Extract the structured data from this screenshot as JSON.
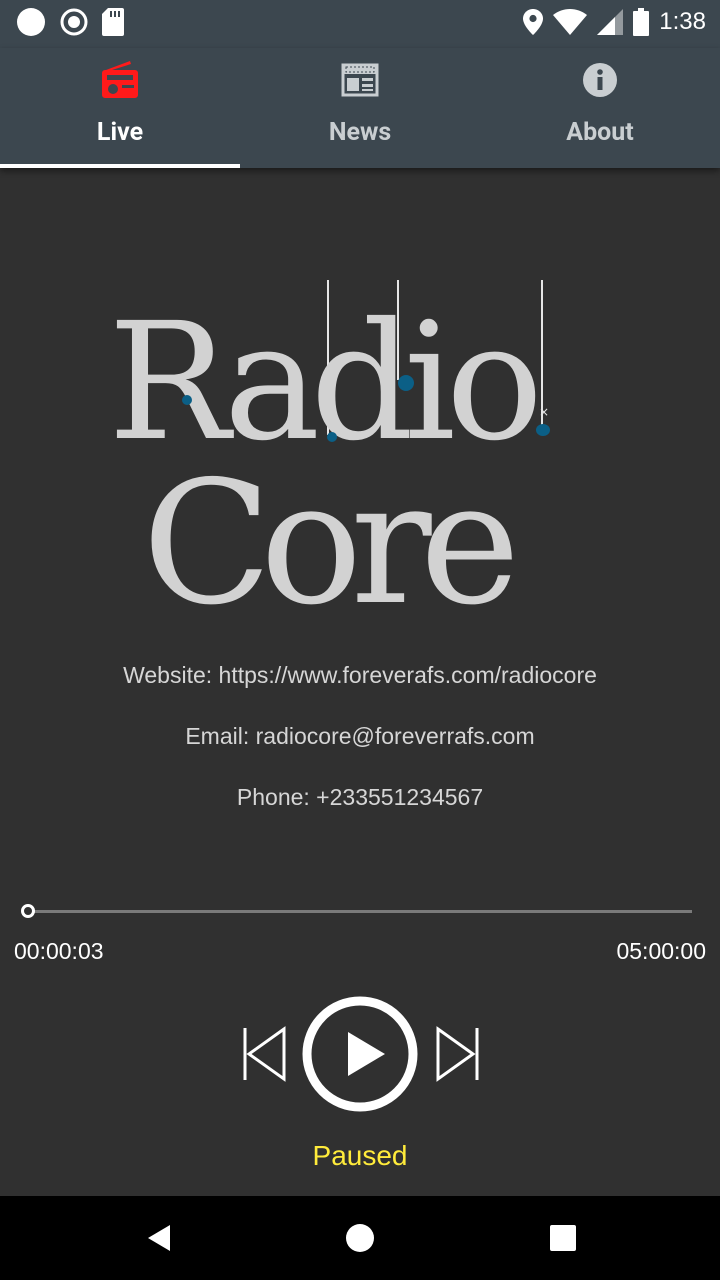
{
  "status_bar": {
    "time": "1:38",
    "left_icons": [
      "notification-dot-icon",
      "record-icon",
      "sd-card-icon"
    ],
    "right_icons": [
      "location-icon",
      "wifi-icon",
      "cell-signal-icon",
      "battery-icon"
    ]
  },
  "tabs": [
    {
      "label": "Live",
      "icon": "radio-icon",
      "active": true,
      "icon_color": "#ff1a1a"
    },
    {
      "label": "News",
      "icon": "newspaper-icon",
      "active": false
    },
    {
      "label": "About",
      "icon": "info-icon",
      "active": false
    }
  ],
  "logo": {
    "line1": "Radio",
    "line2": "Core"
  },
  "info": {
    "website": "Website: https://www.foreverafs.com/radiocore",
    "email": "Email: radiocore@foreverrafs.com",
    "phone": "Phone: +233551234567"
  },
  "player": {
    "elapsed": "00:00:03",
    "duration": "05:00:00",
    "progress": 0.0,
    "status": "Paused"
  },
  "colors": {
    "app_bar": "#3c474f",
    "background": "#303030",
    "status_text": "#ffeb3b",
    "active_tab_icon": "#ff1a1a",
    "logo_accent": "#0b5f86"
  },
  "nav": [
    "back-icon",
    "home-icon",
    "recents-icon"
  ]
}
